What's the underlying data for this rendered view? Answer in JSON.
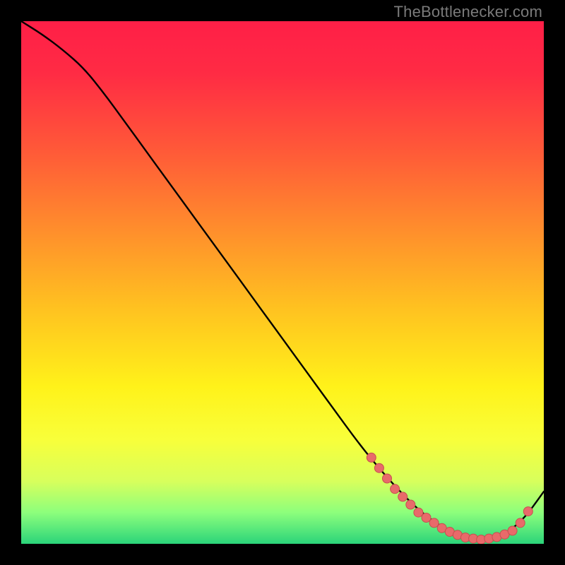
{
  "watermark": "TheBottlenecker.com",
  "colors": {
    "gradient_stops": [
      {
        "offset": 0.0,
        "color": "#ff1f47"
      },
      {
        "offset": 0.1,
        "color": "#ff2b44"
      },
      {
        "offset": 0.25,
        "color": "#ff5a38"
      },
      {
        "offset": 0.4,
        "color": "#ff8e2c"
      },
      {
        "offset": 0.55,
        "color": "#ffc220"
      },
      {
        "offset": 0.7,
        "color": "#fff21a"
      },
      {
        "offset": 0.8,
        "color": "#f8ff3a"
      },
      {
        "offset": 0.88,
        "color": "#d8ff5c"
      },
      {
        "offset": 0.94,
        "color": "#8dff7c"
      },
      {
        "offset": 1.0,
        "color": "#2bd47a"
      }
    ],
    "curve": "#000000",
    "marker_fill": "#e86a6a",
    "marker_stroke": "#c74f4f"
  },
  "chart_data": {
    "type": "line",
    "title": "",
    "xlabel": "",
    "ylabel": "",
    "xlim": [
      0,
      100
    ],
    "ylim": [
      0,
      100
    ],
    "grid": false,
    "series": [
      {
        "name": "bottleneck-curve",
        "x": [
          0,
          4,
          8,
          12,
          16,
          20,
          24,
          28,
          32,
          36,
          40,
          44,
          48,
          52,
          56,
          60,
          64,
          68,
          72,
          76,
          80,
          84,
          88,
          92,
          96,
          100
        ],
        "y": [
          100,
          97.5,
          94.5,
          91,
          86,
          80.5,
          75,
          69.5,
          64,
          58.5,
          53,
          47.5,
          42,
          36.5,
          31,
          25.5,
          20,
          15,
          10.5,
          6.5,
          3.5,
          1.5,
          0.8,
          1.5,
          4.5,
          10
        ]
      }
    ],
    "markers": [
      {
        "x": 67,
        "y": 16.5
      },
      {
        "x": 68.5,
        "y": 14.5
      },
      {
        "x": 70,
        "y": 12.5
      },
      {
        "x": 71.5,
        "y": 10.5
      },
      {
        "x": 73,
        "y": 9
      },
      {
        "x": 74.5,
        "y": 7.5
      },
      {
        "x": 76,
        "y": 6
      },
      {
        "x": 77.5,
        "y": 5
      },
      {
        "x": 79,
        "y": 4
      },
      {
        "x": 80.5,
        "y": 3
      },
      {
        "x": 82,
        "y": 2.3
      },
      {
        "x": 83.5,
        "y": 1.7
      },
      {
        "x": 85,
        "y": 1.2
      },
      {
        "x": 86.5,
        "y": 1
      },
      {
        "x": 88,
        "y": 0.8
      },
      {
        "x": 89.5,
        "y": 1
      },
      {
        "x": 91,
        "y": 1.3
      },
      {
        "x": 92.5,
        "y": 1.8
      },
      {
        "x": 94,
        "y": 2.5
      },
      {
        "x": 95.5,
        "y": 4
      },
      {
        "x": 97,
        "y": 6.2
      }
    ]
  }
}
